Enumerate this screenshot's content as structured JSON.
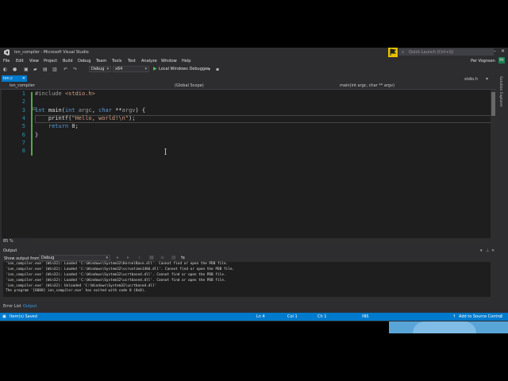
{
  "window": {
    "title": "lon_compiler - Microsoft Visual Studio",
    "quick_launch": "Quick Launch (Ctrl+Q)",
    "user": "Per Vognsen",
    "user_initials": "PV"
  },
  "menu": [
    "File",
    "Edit",
    "View",
    "Project",
    "Build",
    "Debug",
    "Team",
    "Tools",
    "Test",
    "Analyze",
    "Window",
    "Help"
  ],
  "toolbar": {
    "config": "Debug",
    "platform": "x64",
    "debugger": "Local Windows Debugger"
  },
  "tabs": {
    "active": "ion.c",
    "other": "stdio.h"
  },
  "navbar": {
    "project": "lon_compiler",
    "scope": "(Global Scope)",
    "member": "main(int argc, char ** argv)"
  },
  "editor": {
    "line_numbers": [
      "1",
      "2",
      "3",
      "4",
      "5",
      "6",
      "7",
      "8"
    ],
    "current_line": 4,
    "zoom": "85 %"
  },
  "side_panel": "Solution Explorer",
  "output": {
    "title": "Output",
    "show_from_label": "Show output from:",
    "show_from_value": "Debug",
    "lines": [
      "'ion_compiler.exe' (Win32): Loaded 'C:\\Windows\\System32\\KernelBase.dll'. Cannot find or open the PDB file.",
      "'ion_compiler.exe' (Win32): Loaded 'C:\\Windows\\System32\\vcruntime140d.dll'. Cannot find or open the PDB file.",
      "'ion_compiler.exe' (Win32): Loaded 'C:\\Windows\\System32\\ucrtbased.dll'. Cannot find or open the PDB file.",
      "'ion_compiler.exe' (Win32): Loaded 'C:\\Windows\\System32\\ucrtbased.dll'. Cannot find or open the PDB file.",
      "'ion_compiler.exe' (Win32): Unloaded 'C:\\Windows\\System32\\ucrtbased.dll'",
      "The program '[6080] ion_compiler.exe' has exited with code 0 (0x0)."
    ]
  },
  "bottom_tabs": [
    "Error List",
    "Output"
  ],
  "status": {
    "message": "Item(s) Saved",
    "ln": "Ln 4",
    "col": "Col 1",
    "ch": "Ch 1",
    "mode": "INS",
    "source_control": "Add to Source Control"
  }
}
